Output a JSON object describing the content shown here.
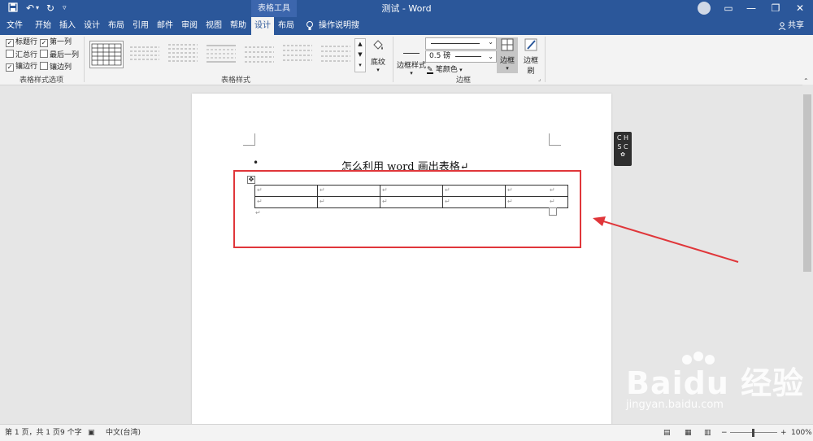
{
  "titlebar": {
    "title": "测试 - Word",
    "context_group": "表格工具",
    "quick_access": [
      "save-icon",
      "undo-icon",
      "redo-icon",
      "customize-icon"
    ],
    "share": "共享"
  },
  "tabs": [
    {
      "label": "文件"
    },
    {
      "label": "开始"
    },
    {
      "label": "插入"
    },
    {
      "label": "设计"
    },
    {
      "label": "布局"
    },
    {
      "label": "引用"
    },
    {
      "label": "邮件"
    },
    {
      "label": "审阅"
    },
    {
      "label": "视图"
    },
    {
      "label": "帮助"
    },
    {
      "label": "设计",
      "active": true
    },
    {
      "label": "布局"
    }
  ],
  "tell_me": "操作说明搜索",
  "ribbon": {
    "table_style_options": {
      "label": "表格样式选项",
      "checkboxes": [
        {
          "label": "标题行",
          "checked": true
        },
        {
          "label": "第一列",
          "checked": true
        },
        {
          "label": "汇总行",
          "checked": false
        },
        {
          "label": "最后一列",
          "checked": false
        },
        {
          "label": "镶边行",
          "checked": true
        },
        {
          "label": "镶边列",
          "checked": false
        }
      ]
    },
    "table_styles": {
      "label": "表格样式",
      "shading": "底纹"
    },
    "borders": {
      "label": "边框",
      "border_styles": "边框样式",
      "weight": "0.5 磅",
      "pen_color": "笔颜色",
      "borders_btn": "边框",
      "border_painter": "边框刷"
    }
  },
  "document": {
    "heading": "怎么利用 word 画出表格↵",
    "bullet": "•",
    "table": {
      "rows": [
        [
          "↵",
          "↵",
          "↵",
          "↵",
          "↵"
        ],
        [
          "↵",
          "↵",
          "↵",
          "↵",
          "↵"
        ]
      ],
      "row_end_mark": "↵"
    },
    "after_table_mark": "↵"
  },
  "statusbar": {
    "page": "第 1 页，共 1 页",
    "words": "9 个字",
    "language": "中文(台湾)",
    "zoom": "100%"
  },
  "ime": {
    "lines": [
      "C H",
      "S C"
    ]
  },
  "watermark": {
    "brand": "Baidu 经验",
    "url": "jingyan.baidu.com"
  },
  "colors": {
    "accent": "#2b579a",
    "highlight": "#e0363a"
  }
}
